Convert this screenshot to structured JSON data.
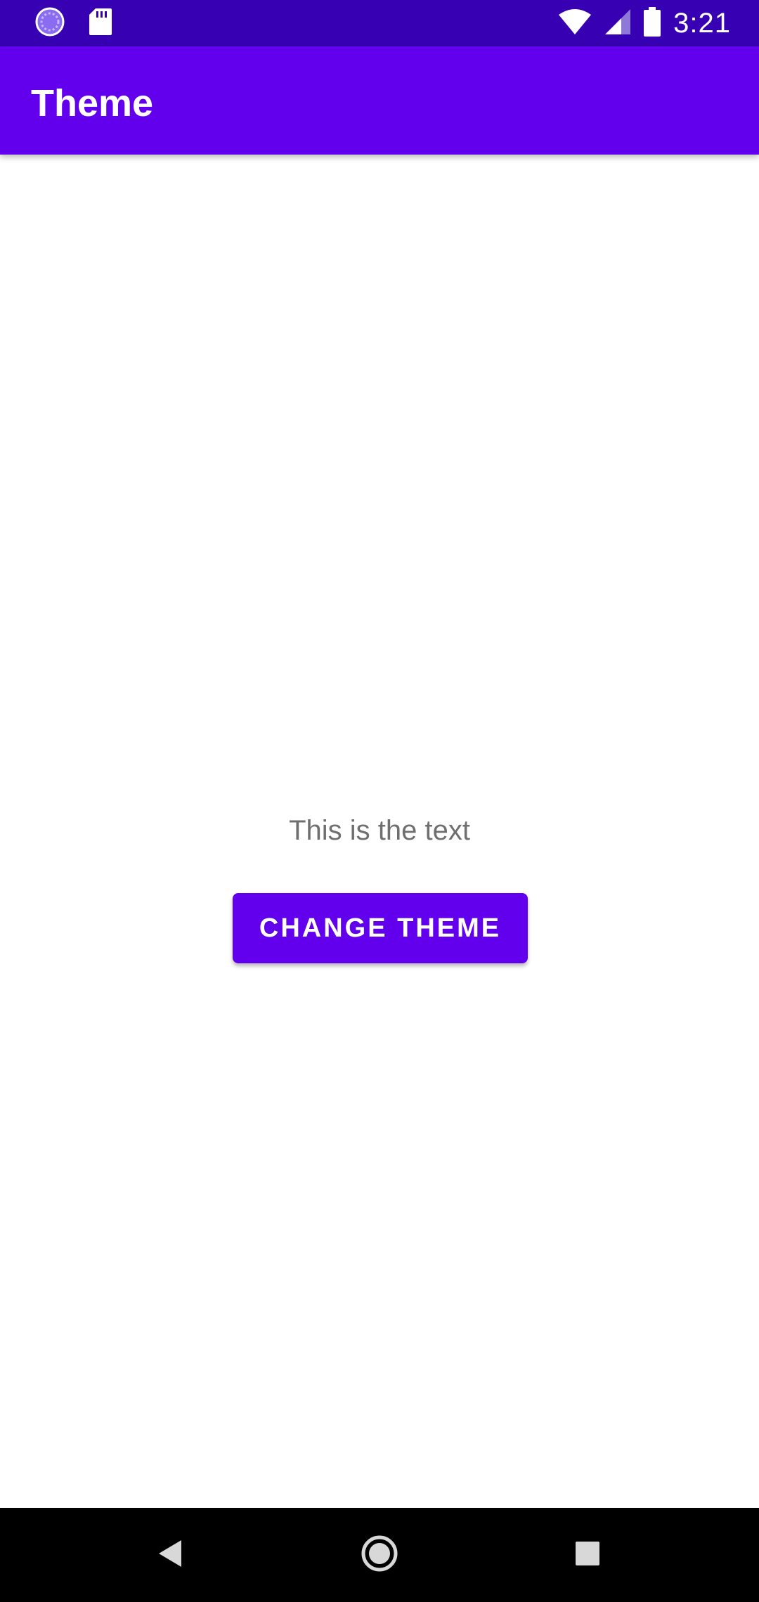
{
  "status_bar": {
    "time": "3:21",
    "left_icons": [
      "sync-icon",
      "sd-card-icon"
    ],
    "right_icons": [
      "wifi-icon",
      "cell-signal-icon",
      "battery-icon"
    ],
    "background_color": "#3700b3"
  },
  "app_bar": {
    "title": "Theme",
    "background_color": "#6200ee"
  },
  "main": {
    "text": "This is the text",
    "button_label": "CHANGE THEME",
    "button_color": "#6200ee",
    "text_color": "#6f6f6f"
  },
  "nav_bar": {
    "buttons": [
      "back-icon",
      "home-icon",
      "recents-icon"
    ]
  }
}
